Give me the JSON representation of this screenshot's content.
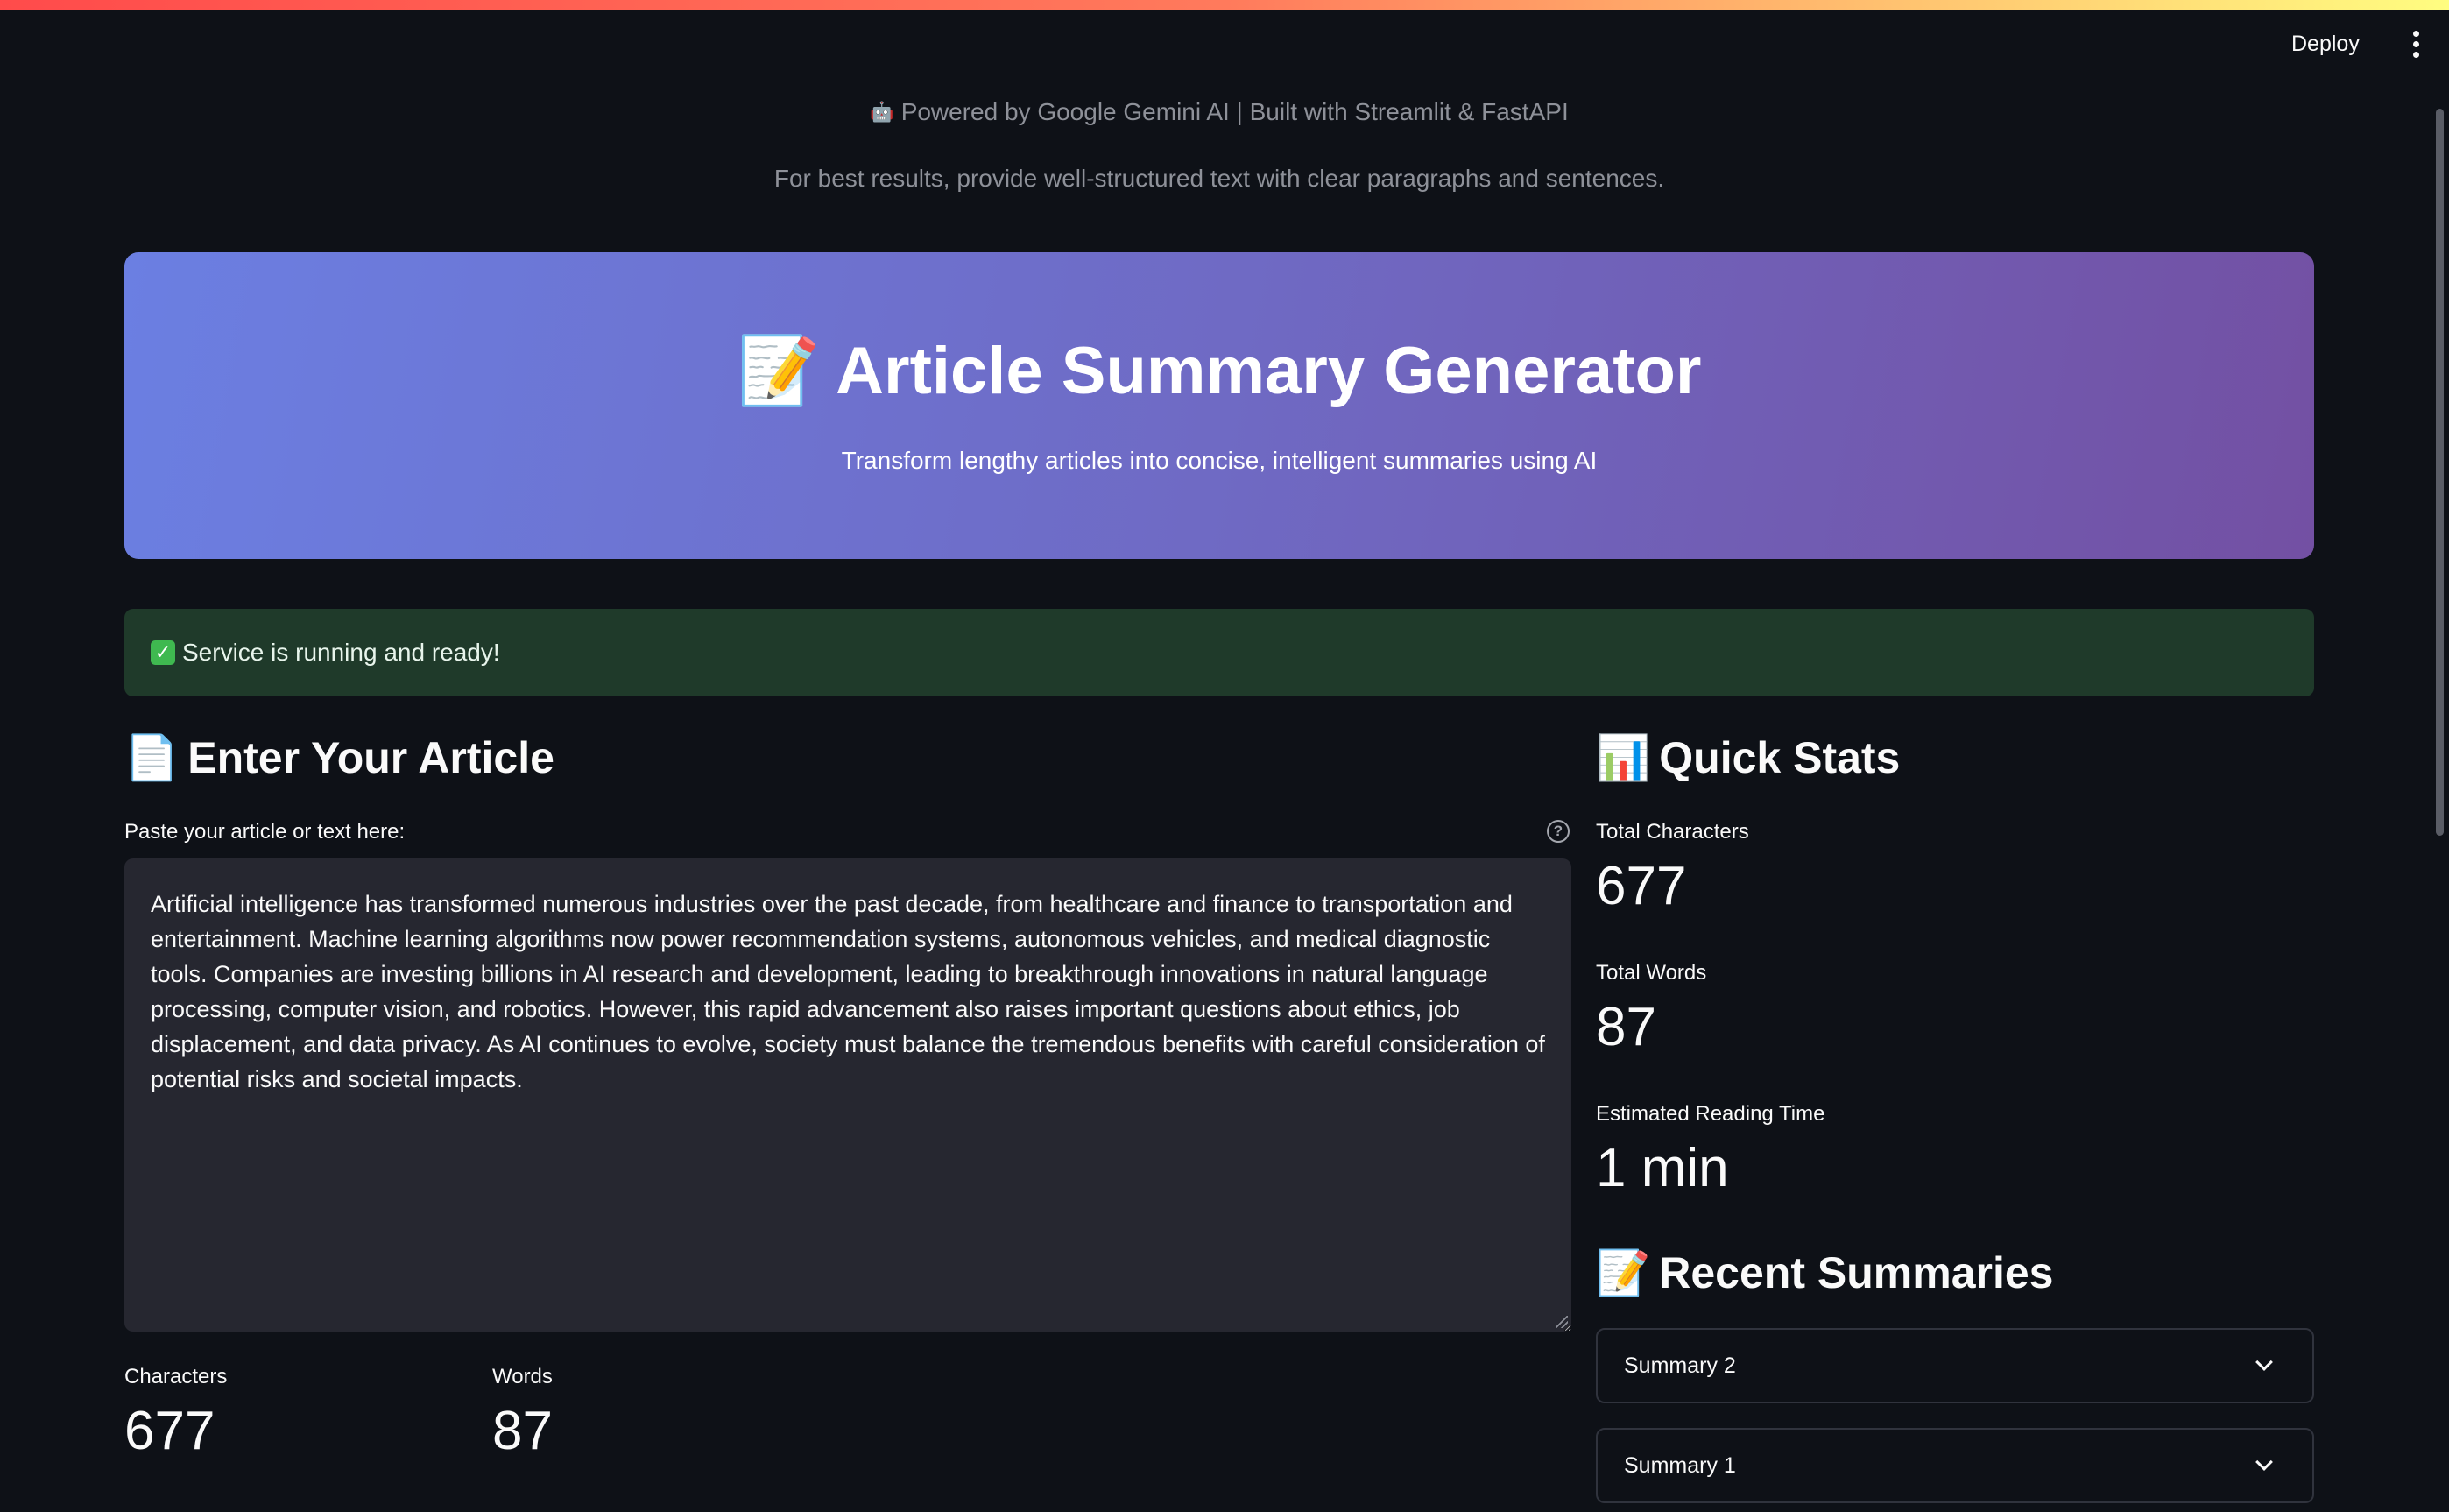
{
  "toolbar": {
    "deploy_label": "Deploy",
    "menu_icon": "more-vertical-icon"
  },
  "header": {
    "powered_by": "Powered by Google Gemini AI | Built with Streamlit & FastAPI",
    "hint": "For best results, provide well-structured text with clear paragraphs and sentences."
  },
  "hero": {
    "icon": "📝",
    "title": "Article Summary Generator",
    "subtitle": "Transform lengthy articles into concise, intelligent summaries using AI"
  },
  "status": {
    "icon": "✓",
    "text": "Service is running and ready!",
    "color": "#3fb950"
  },
  "input_section": {
    "icon": "📄",
    "heading": "Enter Your Article",
    "field_label": "Paste your article or text here:",
    "article_text": "Artificial intelligence has transformed numerous industries over the past decade, from healthcare and finance to transportation and entertainment. Machine learning algorithms now power recommendation systems, autonomous vehicles, and medical diagnostic tools. Companies are investing billions in AI research and development, leading to breakthrough innovations in natural language processing, computer vision, and robotics. However, this rapid advancement also raises important questions about ethics, job displacement, and data privacy. As AI continues to evolve, society must balance the tremendous benefits with careful consideration of potential risks and societal impacts.",
    "characters_label": "Characters",
    "characters_value": "677",
    "words_label": "Words",
    "words_value": "87"
  },
  "stats_section": {
    "icon": "📊",
    "heading": "Quick Stats",
    "total_chars_label": "Total Characters",
    "total_chars_value": "677",
    "total_words_label": "Total Words",
    "total_words_value": "87",
    "reading_time_label": "Estimated Reading Time",
    "reading_time_value": "1 min"
  },
  "recent_section": {
    "icon": "📝",
    "heading": "Recent Summaries",
    "items": [
      {
        "label": "Summary 2"
      },
      {
        "label": "Summary 1"
      }
    ]
  },
  "colors": {
    "background": "#0e1117",
    "hero_gradient_start": "#6b7fe2",
    "hero_gradient_end": "#7350a3",
    "success_bg": "#1f3a2a",
    "input_bg": "#262730"
  }
}
